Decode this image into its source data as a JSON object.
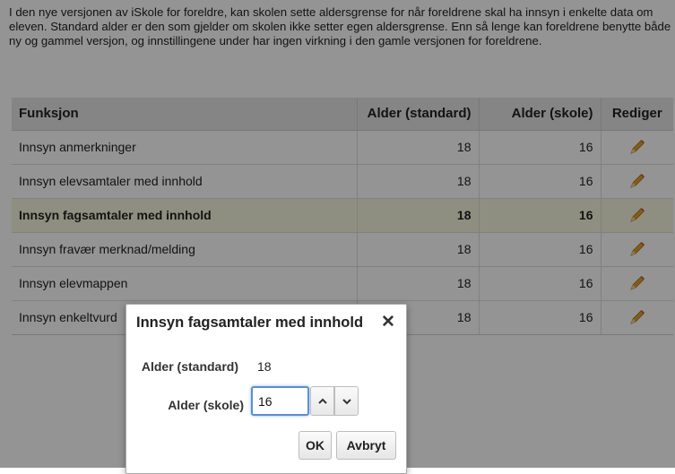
{
  "intro": {
    "text": "I den nye versjonen av iSkole for foreldre, kan skolen sette aldersgrense for når foreldrene skal ha innsyn i enkelte data om eleven. Standard alder er den som gjelder om skolen ikke setter egen aldersgrense. Enn så lenge kan foreldrene benytte både ny og gammel versjon, og innstillingene under har ingen virkning i den gamle versjonen for foreldrene."
  },
  "table": {
    "headers": {
      "function": "Funksjon",
      "age_default": "Alder (standard)",
      "age_school": "Alder (skole)",
      "edit": "Rediger"
    },
    "rows": [
      {
        "function": "Innsyn anmerkninger",
        "age_default": "18",
        "age_school": "16"
      },
      {
        "function": "Innsyn elevsamtaler med innhold",
        "age_default": "18",
        "age_school": "16"
      },
      {
        "function": "Innsyn fagsamtaler med innhold",
        "age_default": "18",
        "age_school": "16"
      },
      {
        "function": "Innsyn fravær merknad/melding",
        "age_default": "18",
        "age_school": "16"
      },
      {
        "function": "Innsyn elevmappen",
        "age_default": "18",
        "age_school": "16"
      },
      {
        "function": "Innsyn enkeltvurd",
        "age_default": "18",
        "age_school": "16"
      }
    ],
    "edit_icon": "pencil-icon"
  },
  "dialog": {
    "title": "Innsyn fagsamtaler med innhold",
    "close_symbol": "✕",
    "default_label": "Alder (standard)",
    "default_value": "18",
    "school_label": "Alder (skole)",
    "school_value": "16",
    "ok_label": "OK",
    "cancel_label": "Avbryt"
  },
  "colors": {
    "selected_row": "#f6f6df",
    "header_bg": "#e6e6e6",
    "focus_ring": "#5a8fd6",
    "pencil": "#e0a030"
  }
}
